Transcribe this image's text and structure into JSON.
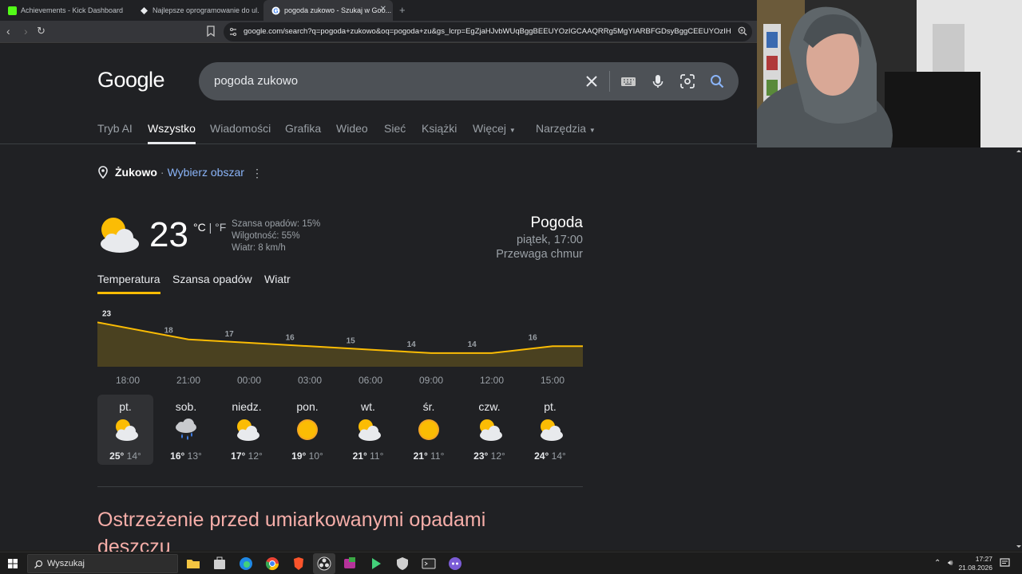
{
  "browser": {
    "tabs": [
      {
        "title": "Achievements - Kick Dashboard",
        "favicon_color": "#53fc18",
        "active": false
      },
      {
        "title": "Najlepsze oprogramowanie do ul...",
        "favicon_color": "#e8eaed",
        "active": false
      },
      {
        "title": "pogoda zukowo - Szukaj w Goo...",
        "favicon_color": "#ffffff",
        "active": true
      }
    ],
    "new_tab_symbol": "+",
    "url": "google.com/search?q=pogoda+zukowo&oq=pogoda+zu&gs_lcrp=EgZjaHJvbWUqBggBEEUYOzIGCAAQRRg5MgYIARBFGDsyBggCEEUYOzIHCAMQ..."
  },
  "google": {
    "logo": "Google",
    "query": "pogoda zukowo",
    "tabs": [
      "Tryb AI",
      "Wszystko",
      "Wiadomości",
      "Grafika",
      "Wideo",
      "Sieć",
      "Książki",
      "Więcej",
      "Narzędzia"
    ],
    "active_tab": "Wszystko"
  },
  "location": {
    "name": "Żukowo",
    "separator": "·",
    "link": "Wybierz obszar"
  },
  "weather": {
    "icon": "partly-cloudy-icon",
    "temp": "23",
    "unit_c": "°C",
    "unit_sep": "|",
    "unit_f": "°F",
    "precip": "Szansa opadów: 15%",
    "humidity": "Wilgotność: 55%",
    "wind": "Wiatr: 8 km/h",
    "title": "Pogoda",
    "datetime": "piątek, 17:00",
    "condition": "Przewaga chmur"
  },
  "chart_tabs": [
    "Temperatura",
    "Szansa opadów",
    "Wiatr"
  ],
  "chart_data": {
    "type": "area",
    "x": [
      "18:00",
      "21:00",
      "00:00",
      "03:00",
      "06:00",
      "09:00",
      "12:00",
      "15:00"
    ],
    "values": [
      23,
      18,
      17,
      16,
      15,
      14,
      14,
      16
    ],
    "labels": [
      "23",
      "18",
      "17",
      "16",
      "15",
      "14",
      "14",
      "16"
    ],
    "line_color": "#fbbc04",
    "fill_color": "#4a4120"
  },
  "forecast": [
    {
      "day": "pt.",
      "icon": "partly-cloudy-icon",
      "hi": "25°",
      "lo": "14°"
    },
    {
      "day": "sob.",
      "icon": "rain-cloud-icon",
      "hi": "16°",
      "lo": "13°"
    },
    {
      "day": "niedz.",
      "icon": "partly-cloudy-icon",
      "hi": "17°",
      "lo": "12°"
    },
    {
      "day": "pon.",
      "icon": "sun-icon",
      "hi": "19°",
      "lo": "10°"
    },
    {
      "day": "wt.",
      "icon": "partly-cloudy-icon",
      "hi": "21°",
      "lo": "11°"
    },
    {
      "day": "śr.",
      "icon": "sun-icon",
      "hi": "21°",
      "lo": "11°"
    },
    {
      "day": "czw.",
      "icon": "partly-cloudy-icon",
      "hi": "23°",
      "lo": "12°"
    },
    {
      "day": "pt.",
      "icon": "partly-cloudy-icon",
      "hi": "24°",
      "lo": "14°"
    }
  ],
  "warning": "Ostrzeżenie przed umiarkowanymi opadami deszczu",
  "taskbar": {
    "search_placeholder": "Wyszukaj",
    "time": "17:27",
    "date": "21.08.2026"
  }
}
